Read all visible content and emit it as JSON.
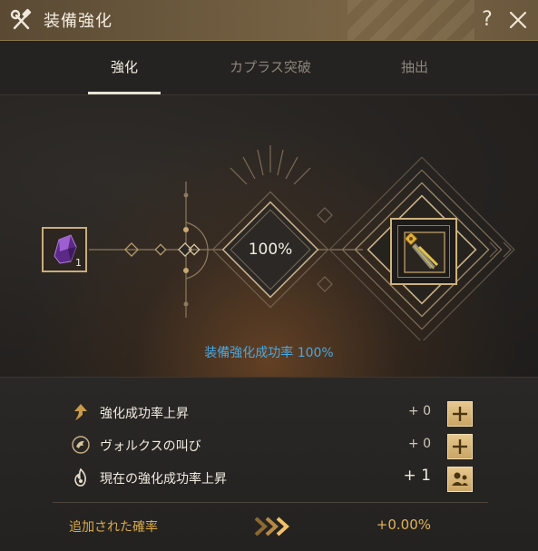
{
  "window": {
    "title": "装備強化",
    "help_label": "?"
  },
  "tabs": [
    {
      "label": "強化",
      "active": true
    },
    {
      "label": "カプラス突破",
      "active": false
    },
    {
      "label": "抽出",
      "active": false
    }
  ],
  "enhance": {
    "material_count": "1",
    "success_percent": "100%",
    "success_rate_text": "装備強化成功率 100%"
  },
  "bonuses": [
    {
      "label": "強化成功率上昇",
      "value": "+ 0",
      "icon": "arrow-up-icon",
      "button_icon": "plus-icon"
    },
    {
      "label": "ヴォルクスの叫び",
      "value": "+ 0",
      "icon": "wolf-emblem-icon",
      "button_icon": "plus-icon"
    },
    {
      "label": "現在の強化成功率上昇",
      "value": "+ 1",
      "icon": "flame-icon",
      "button_icon": "party-icon"
    }
  ],
  "added_probability": {
    "label": "追加された確率",
    "value": "+0.00%",
    "icon": "triple-chevron-icon"
  },
  "colors": {
    "titlebar": "#6e5b3f",
    "accent_gold": "#d8a94a",
    "rate_blue": "#4aa8e0",
    "button_gold": "#d9b878"
  }
}
